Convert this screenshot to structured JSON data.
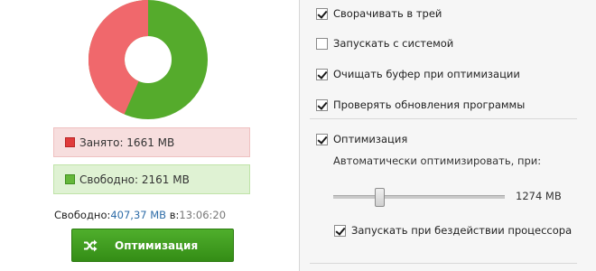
{
  "memory": {
    "used_fraction": 0.4346,
    "colors": {
      "used": "#f0686c",
      "free": "#55ab2c"
    },
    "used_text": "Занято: 1661 MB",
    "free_text": "Свободно: 2161 MB",
    "freed_prefix": "Свободно:",
    "freed_value": "407,37 MB",
    "freed_mid": "в:",
    "freed_time": "13:06:20"
  },
  "optimize_button": {
    "label": "Оптимизация",
    "icon": "shuffle-icon"
  },
  "settings": {
    "minimize_to_tray": {
      "label": "Сворачивать в трей",
      "checked": true
    },
    "start_with_system": {
      "label": "Запускать с системой",
      "checked": false
    },
    "clear_clipboard": {
      "label": "Очищать буфер при оптимизации",
      "checked": true
    },
    "check_updates": {
      "label": "Проверять обновления программы",
      "checked": true
    },
    "optimization": {
      "label": "Оптимизация",
      "checked": true
    },
    "auto_optimize_label": "Автоматически оптимизировать, при:",
    "threshold": {
      "value_text": "1274 MB",
      "fraction": 0.27
    },
    "cpu_idle": {
      "label": "Запускать при бездействии процессора",
      "checked": true
    }
  }
}
